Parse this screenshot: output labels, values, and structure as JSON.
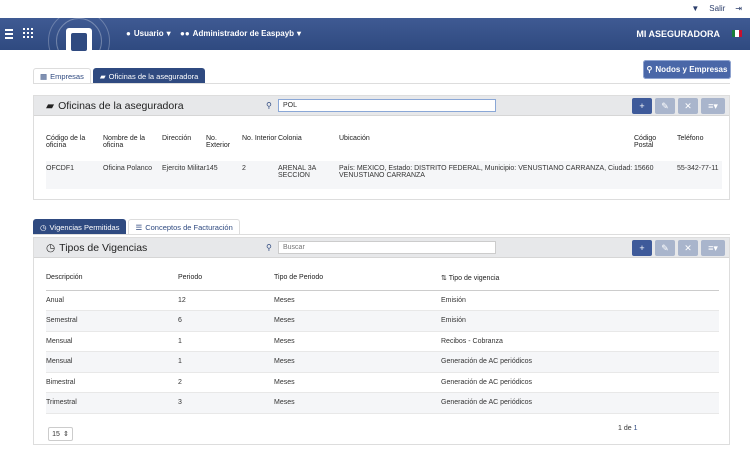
{
  "topbar": {
    "logout_label": "Salir"
  },
  "nav": {
    "user_menu": "Usuario",
    "admin_menu": "Administrador de Easpayb",
    "company_title": "MI ASEGURADORA"
  },
  "top_tabs": [
    {
      "label": "Empresas"
    },
    {
      "label": "Oficinas de la aseguradora"
    }
  ],
  "nodos_button": "Nodos y Empresas",
  "oficinas": {
    "title": "Oficinas de la aseguradora",
    "search_value": "POL",
    "columns": [
      "Código de la oficina",
      "Nombre de la oficina",
      "Dirección",
      "No. Exterior",
      "No. Interior",
      "Colonia",
      "Ubicación",
      "Código Postal",
      "Teléfono"
    ],
    "rows": [
      [
        "OFCDF1",
        "Oficina Polanco",
        "Ejercito Militar",
        "145",
        "2",
        "ARENAL 3A SECCION",
        "País: MEXICO, Estado: DISTRITO FEDERAL, Municipio: VENUSTIANO CARRANZA, Ciudad: VENUSTIANO CARRANZA",
        "15660",
        "55-342-77-11"
      ]
    ]
  },
  "bottom_tabs": [
    {
      "label": "Vigencias Permitidas"
    },
    {
      "label": "Conceptos de Facturación"
    }
  ],
  "vigencias": {
    "title": "Tipos de Vigencias",
    "search_placeholder": "Buscar",
    "columns": [
      "Descripción",
      "Periodo",
      "Tipo de Periodo",
      "Tipo de vigencia"
    ],
    "rows": [
      [
        "Anual",
        "12",
        "Meses",
        "Emisión"
      ],
      [
        "Semestral",
        "6",
        "Meses",
        "Emisión"
      ],
      [
        "Mensual",
        "1",
        "Meses",
        "Recibos - Cobranza"
      ],
      [
        "Mensual",
        "1",
        "Meses",
        "Generación de AC periódicos"
      ],
      [
        "Bimestral",
        "2",
        "Meses",
        "Generación de AC periódicos"
      ],
      [
        "Trimestral",
        "3",
        "Meses",
        "Generación de AC periódicos"
      ]
    ],
    "page_size": "15",
    "page_current": "1",
    "page_of": "de",
    "page_total": "1"
  },
  "colors": {
    "primary": "#2f4a80",
    "accent": "#3e5a9a"
  }
}
